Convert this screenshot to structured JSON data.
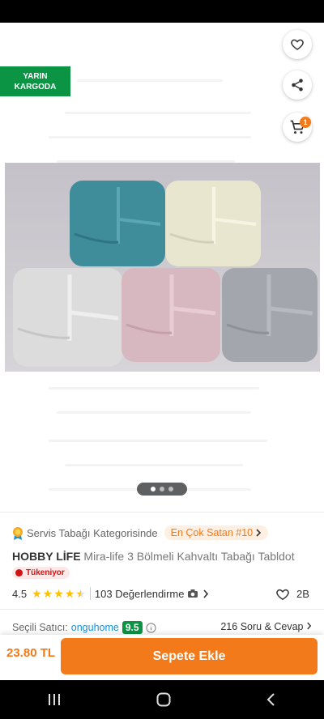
{
  "badges": {
    "cargo_line1": "YARIN",
    "cargo_line2": "KARGODA",
    "cart_count": "1"
  },
  "gallery": {
    "image_count": 3,
    "active_index": 1
  },
  "category": {
    "text": "Servis Tabağı Kategorisinde",
    "bestseller": "En Çok Satan #10"
  },
  "product": {
    "brand": "HOBBY LİFE",
    "name": "Mira-life 3 Bölmeli Kahvaltı Tabağı Tabldot",
    "stock": "Tükeniyor"
  },
  "rating": {
    "score": "4.5",
    "reviews": "103 Değerlendirme",
    "likes": "2B"
  },
  "seller": {
    "label": "Seçili Satıcı:",
    "name": "onguhome",
    "score": "9.5",
    "qa": "216 Soru & Cevap"
  },
  "bottom": {
    "price": "23.80 TL",
    "add_to_cart": "Sepete Ekle"
  },
  "colors": {
    "brand": "#f27a1a",
    "green": "#0b9444",
    "red": "#d21313",
    "link": "#1b8fd6"
  },
  "icons": [
    "back-arrow-icon",
    "heart-icon",
    "share-icon",
    "cart-icon",
    "medal-icon",
    "chevron-right-icon",
    "camera-icon",
    "info-icon",
    "menu-icon",
    "home-icon"
  ]
}
